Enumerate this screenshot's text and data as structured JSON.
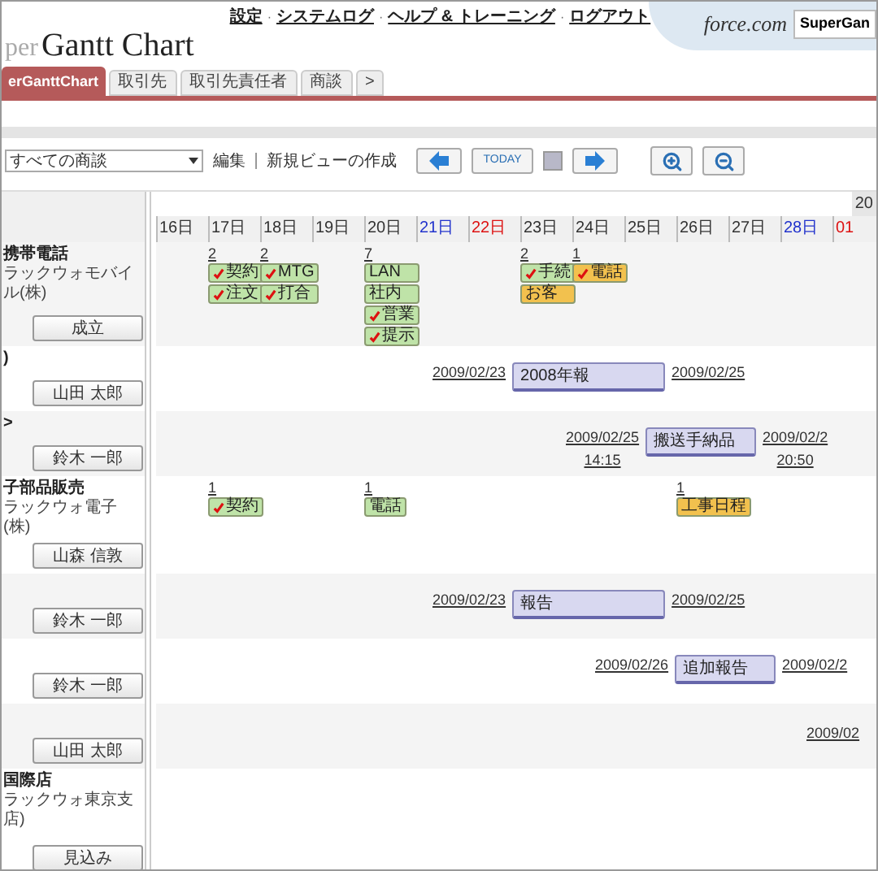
{
  "header": {
    "logo_fragment": "per",
    "title": "Gantt Chart",
    "links": [
      "設定",
      "システムログ",
      "ヘルプ & トレーニング",
      "ログアウト"
    ],
    "separator": "·",
    "brand": "force.com",
    "app_menu": "SuperGan"
  },
  "tabs": [
    {
      "label": "erGanttChart",
      "selected": true
    },
    {
      "label": "取引先",
      "selected": false
    },
    {
      "label": "取引先責任者",
      "selected": false
    },
    {
      "label": "商談",
      "selected": false
    },
    {
      "label": ">",
      "selected": false
    }
  ],
  "toolbar": {
    "view_select": "すべての商談",
    "links": [
      "編集",
      "新規ビューの作成"
    ],
    "today": "TODAY"
  },
  "timeline": {
    "year": "20",
    "days": [
      {
        "label": "16日",
        "kind": "weekday"
      },
      {
        "label": "17日",
        "kind": "weekday"
      },
      {
        "label": "18日",
        "kind": "weekday"
      },
      {
        "label": "19日",
        "kind": "weekday"
      },
      {
        "label": "20日",
        "kind": "weekday"
      },
      {
        "label": "21日",
        "kind": "saturday"
      },
      {
        "label": "22日",
        "kind": "sunday"
      },
      {
        "label": "23日",
        "kind": "weekday"
      },
      {
        "label": "24日",
        "kind": "weekday"
      },
      {
        "label": "25日",
        "kind": "weekday"
      },
      {
        "label": "26日",
        "kind": "weekday"
      },
      {
        "label": "27日",
        "kind": "weekday"
      },
      {
        "label": "28日",
        "kind": "saturday"
      },
      {
        "label": "01",
        "kind": "sunday"
      }
    ]
  },
  "rows": [
    {
      "name": "携帯電話",
      "subtitle": "ラックウォモバイル(株)",
      "owner": "成立",
      "items": [
        {
          "kind": "activities",
          "count": "2",
          "chips": [
            {
              "label": "契約",
              "checked": true,
              "color": "#bfe3a8"
            },
            {
              "label": "注文",
              "checked": true,
              "color": "#bfe3a8"
            }
          ]
        },
        {
          "kind": "activities",
          "count": "2",
          "chips": [
            {
              "label": "MTG",
              "checked": true,
              "color": "#bfe3a8"
            },
            {
              "label": "打合",
              "checked": true,
              "color": "#bfe3a8"
            }
          ]
        },
        {
          "kind": "activities",
          "count": "7",
          "chips": [
            {
              "label": "LAN",
              "checked": false,
              "color": "#bfe3a8"
            },
            {
              "label": "社内",
              "checked": false,
              "color": "#bfe3a8"
            },
            {
              "label": "営業",
              "checked": true,
              "color": "#bfe3a8"
            },
            {
              "label": "提示",
              "checked": true,
              "color": "#bfe3a8"
            }
          ]
        },
        {
          "kind": "activities",
          "count": "2",
          "chips": [
            {
              "label": "手続",
              "checked": true,
              "color": "#bfe3a8"
            },
            {
              "label": "お客",
              "checked": false,
              "color": "#f2c14e"
            }
          ]
        },
        {
          "kind": "activities",
          "count": "1",
          "chips": [
            {
              "label": "電話",
              "checked": true,
              "color": "#f2c14e"
            }
          ]
        }
      ]
    },
    {
      "name": ")",
      "owner": "山田 太郎",
      "items": [
        {
          "kind": "bar",
          "start": "2009/02/23",
          "label": "2008年報",
          "end": "2009/02/25"
        }
      ]
    },
    {
      "name": ">",
      "owner": "鈴木 一郎",
      "items": [
        {
          "kind": "bar",
          "start": "2009/02/25",
          "start_time": "14:15",
          "label": "搬送手納品",
          "end": "2009/02/2",
          "end_time": "20:50"
        }
      ]
    },
    {
      "name": "子部品販売",
      "subtitle": "ラックウォ電子(株)",
      "owner": "山森 信敦",
      "items": [
        {
          "kind": "activities",
          "count": "1",
          "chips": [
            {
              "label": "契約",
              "checked": true,
              "color": "#bfe3a8"
            }
          ]
        },
        {
          "kind": "activities",
          "count": "1",
          "chips": [
            {
              "label": "電話",
              "checked": false,
              "color": "#bfe3a8"
            }
          ]
        },
        {
          "kind": "activities",
          "count": "1",
          "chips": [
            {
              "label": "工事日程",
              "checked": false,
              "color": "#f2c14e"
            }
          ]
        }
      ]
    },
    {
      "owner": "鈴木 一郎",
      "items": [
        {
          "kind": "bar",
          "start": "2009/02/23",
          "label": "報告",
          "end": "2009/02/25"
        }
      ]
    },
    {
      "owner": "鈴木 一郎",
      "items": [
        {
          "kind": "bar",
          "start": "2009/02/26",
          "label": "追加報告",
          "end": "2009/02/2"
        }
      ]
    },
    {
      "owner": "山田 太郎",
      "items": [
        {
          "kind": "link",
          "start": "2009/02"
        }
      ]
    },
    {
      "name": "国際店",
      "subtitle": "ラックウォ東京支店)",
      "owner": "見込み",
      "items": []
    }
  ]
}
